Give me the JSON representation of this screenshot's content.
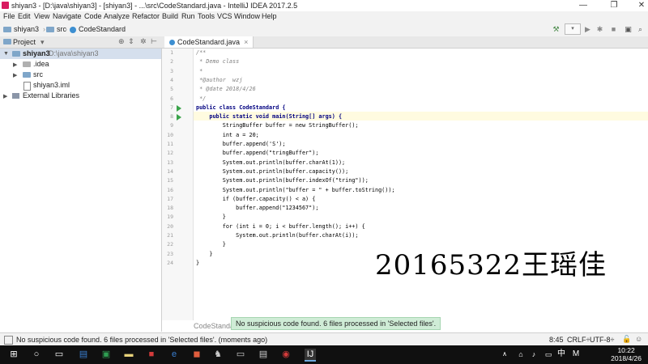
{
  "window": {
    "title": "shiyan3 - [D:\\java\\shiyan3] - [shiyan3] - ...\\src\\CodeStandard.java - IntelliJ IDEA 2017.2.5",
    "minimize": "—",
    "maximize": "❐",
    "close": "✕"
  },
  "menu": [
    "File",
    "Edit",
    "View",
    "Navigate",
    "Code",
    "Analyze",
    "Refactor",
    "Build",
    "Run",
    "Tools",
    "VCS",
    "Window",
    "Help"
  ],
  "nav": {
    "project": "shiyan3",
    "folder": "src",
    "file": "CodeStandard"
  },
  "project_panel": {
    "header": "Project",
    "root_name": "shiyan3",
    "root_path": "D:\\java\\shiyan3",
    "items": [
      ".idea",
      "src",
      "shiyan3.iml"
    ],
    "external": "External Libraries"
  },
  "editor": {
    "tab": "CodeStandard.java",
    "lines": [
      {
        "n": "1",
        "t": "/**",
        "c": "comment"
      },
      {
        "n": "2",
        "t": " * Demo class",
        "c": "comment"
      },
      {
        "n": "3",
        "t": " *",
        "c": "comment"
      },
      {
        "n": "4",
        "t": " *@author  wzj",
        "c": "comment"
      },
      {
        "n": "5",
        "t": " * @date 2018/4/26",
        "c": "comment"
      },
      {
        "n": "6",
        "t": " */",
        "c": "comment"
      },
      {
        "n": "7",
        "t": "public class CodeStandard {",
        "c": "kw"
      },
      {
        "n": "8",
        "t": "    public static void main(String[] args) {",
        "c": "kw"
      },
      {
        "n": "9",
        "t": "        StringBuffer buffer = new StringBuffer();",
        "c": ""
      },
      {
        "n": "10",
        "t": "        int a = 20;",
        "c": ""
      },
      {
        "n": "11",
        "t": "        buffer.append('S');",
        "c": ""
      },
      {
        "n": "12",
        "t": "        buffer.append(\"tringBuffer\");",
        "c": ""
      },
      {
        "n": "13",
        "t": "        System.out.println(buffer.charAt(1));",
        "c": ""
      },
      {
        "n": "14",
        "t": "        System.out.println(buffer.capacity());",
        "c": ""
      },
      {
        "n": "15",
        "t": "        System.out.println(buffer.indexOf(\"tring\"));",
        "c": ""
      },
      {
        "n": "16",
        "t": "        System.out.println(\"buffer = \" + buffer.toString());",
        "c": ""
      },
      {
        "n": "17",
        "t": "        if (buffer.capacity() < a) {",
        "c": ""
      },
      {
        "n": "18",
        "t": "            buffer.append(\"1234567\");",
        "c": ""
      },
      {
        "n": "19",
        "t": "        }",
        "c": ""
      },
      {
        "n": "20",
        "t": "        for (int i = 0; i < buffer.length(); i++) {",
        "c": ""
      },
      {
        "n": "21",
        "t": "            System.out.println(buffer.charAt(i));",
        "c": ""
      },
      {
        "n": "22",
        "t": "        }",
        "c": ""
      },
      {
        "n": "23",
        "t": "    }",
        "c": ""
      },
      {
        "n": "24",
        "t": "}",
        "c": ""
      }
    ],
    "bottom_tab": "CodeStandard"
  },
  "popup": "No suspicious code found. 6 files processed in 'Selected files'.",
  "status": {
    "message": "No suspicious code found. 6 files processed in 'Selected files'. (moments ago)",
    "position": "8:45",
    "line_sep": "CRLF÷",
    "encoding": "UTF-8÷"
  },
  "watermark": "20165322王瑶佳",
  "taskbar": {
    "time": "10:22",
    "date": "2018/4/26",
    "ime": "中"
  }
}
